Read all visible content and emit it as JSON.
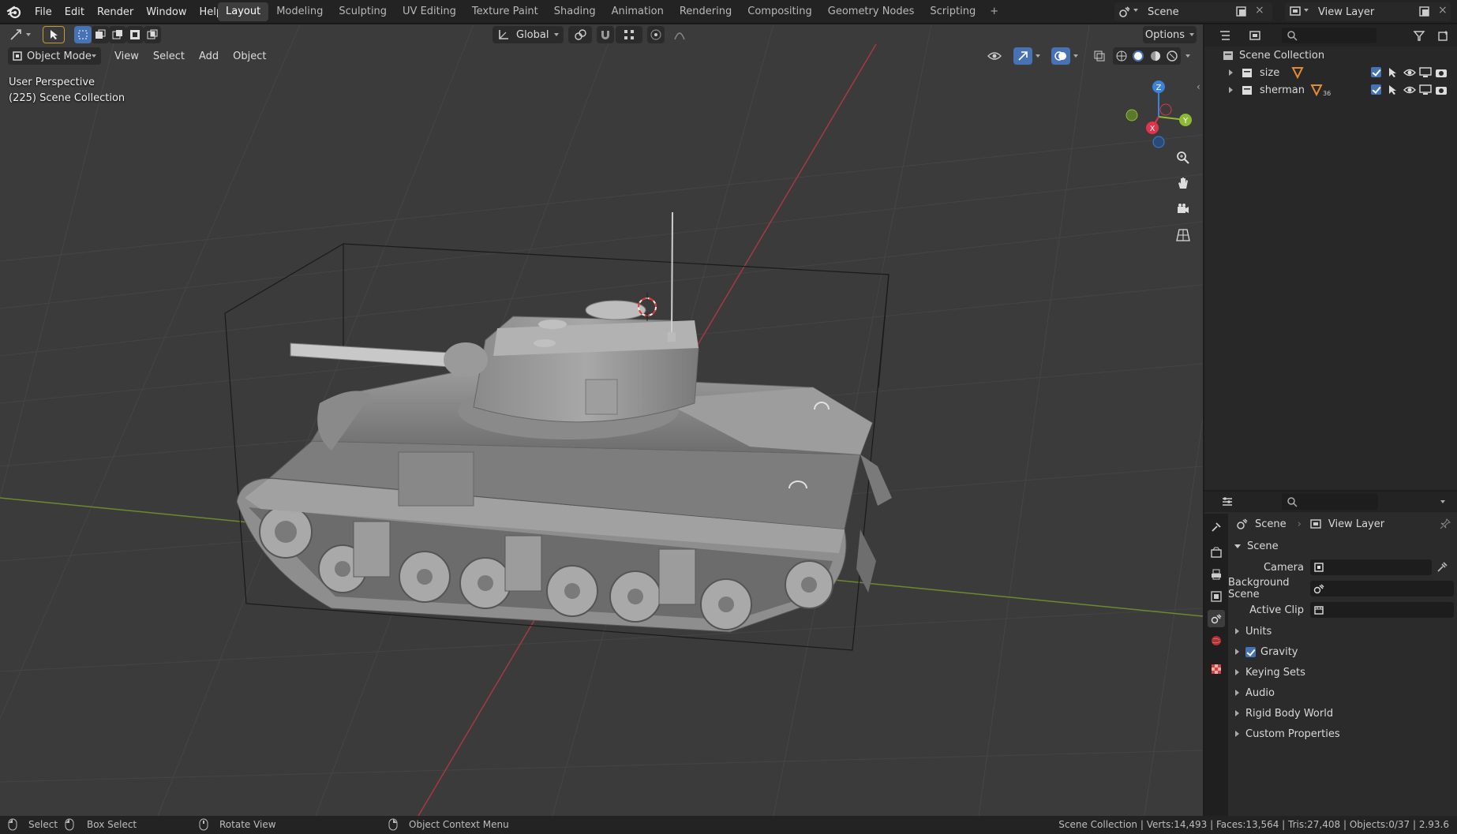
{
  "menu": [
    "File",
    "Edit",
    "Render",
    "Window",
    "Help"
  ],
  "workspaces": [
    "Layout",
    "Modeling",
    "Sculpting",
    "UV Editing",
    "Texture Paint",
    "Shading",
    "Animation",
    "Rendering",
    "Compositing",
    "Geometry Nodes",
    "Scripting"
  ],
  "active_workspace": "Layout",
  "scene_selector": "Scene",
  "view_layer_selector": "View Layer",
  "viewport": {
    "mode": "Object Mode",
    "menus": [
      "View",
      "Select",
      "Add",
      "Object"
    ],
    "transform_orientation": "Global",
    "options_label": "Options",
    "overlay_line1": "User Perspective",
    "overlay_line2": "(225) Scene Collection",
    "gizmo_axes": {
      "x": "X",
      "y": "Y",
      "z": "Z"
    }
  },
  "outliner": {
    "root": "Scene Collection",
    "items": [
      {
        "name": "size"
      },
      {
        "name": "sherman",
        "badge": "36"
      }
    ]
  },
  "properties": {
    "breadcrumb_scene": "Scene",
    "breadcrumb_view_layer": "View Layer",
    "panel_title": "Scene",
    "camera_label": "Camera",
    "background_scene_label": "Background Scene",
    "active_clip_label": "Active Clip",
    "subpanels": [
      "Units",
      "Gravity",
      "Keying Sets",
      "Audio",
      "Rigid Body World",
      "Custom Properties"
    ],
    "gravity_checked": true
  },
  "status": {
    "select": "Select",
    "box_select": "Box Select",
    "rotate_view": "Rotate View",
    "context_menu": "Object Context Menu",
    "stats": "Scene Collection | Verts:14,493 | Faces:13,564 | Tris:27,408 | Objects:0/37 | 2.93.6"
  },
  "colors": {
    "accent": "#4772b3",
    "x_axis": "#e2334c",
    "y_axis": "#8cba35",
    "z_axis": "#3b82d9"
  }
}
